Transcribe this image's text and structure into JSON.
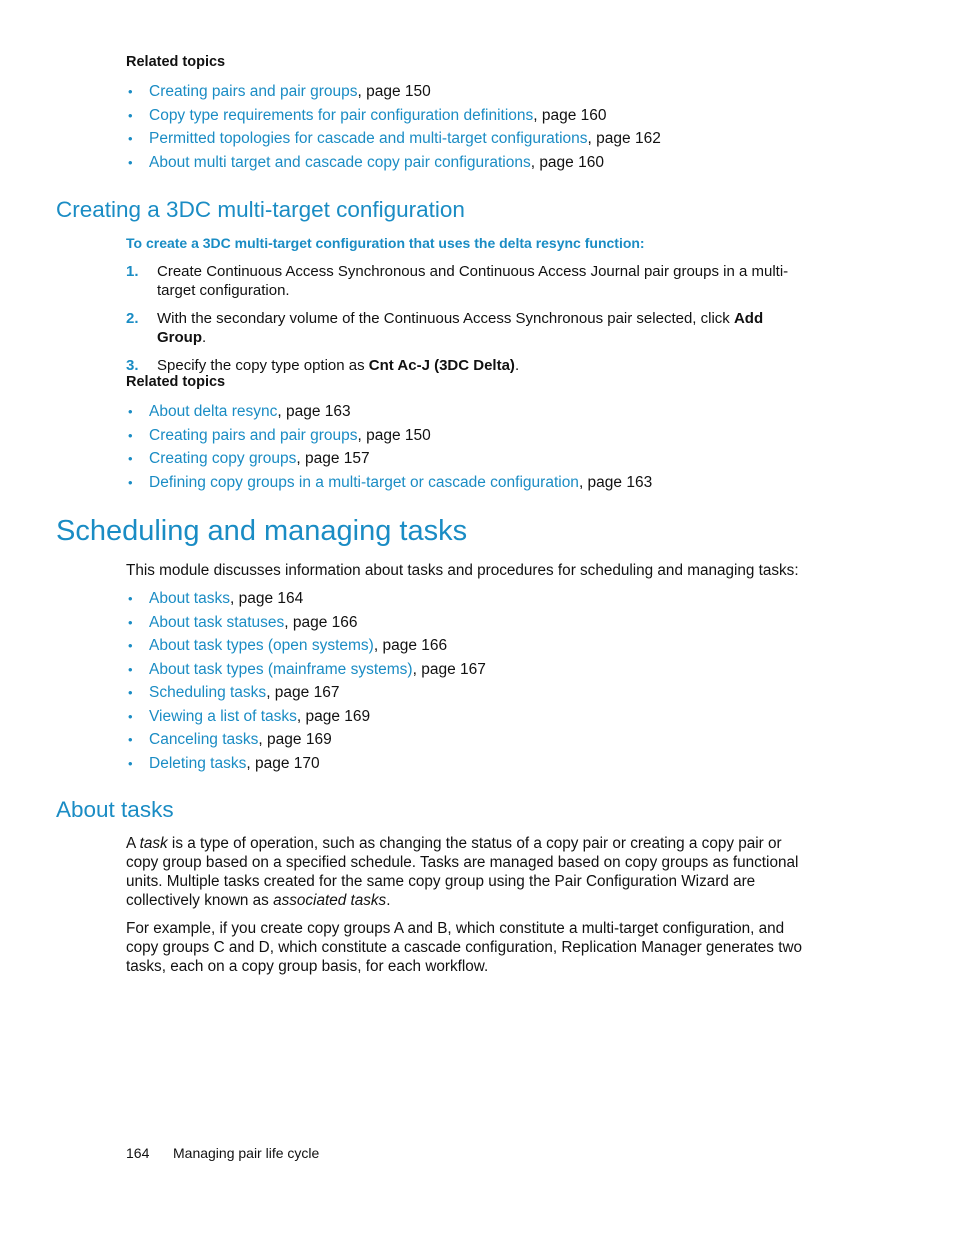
{
  "section1": {
    "related_title": "Related topics",
    "items": [
      {
        "link": "Creating pairs and pair groups",
        "suffix": ", page 150"
      },
      {
        "link": "Copy type requirements for pair configuration definitions",
        "suffix": ", page 160"
      },
      {
        "link": "Permitted topologies for cascade and multi-target configurations",
        "suffix": ", page 162"
      },
      {
        "link": "About multi target and cascade copy pair configurations",
        "suffix": ", page 160"
      }
    ]
  },
  "section2": {
    "heading": "Creating a 3DC multi-target configuration",
    "procedure_title": "To create a 3DC multi-target configuration that uses the delta resync function:",
    "steps": [
      {
        "num": "1.",
        "text": "Create Continuous Access Synchronous and Continuous Access Journal pair groups in a multi-target configuration."
      },
      {
        "num": "2.",
        "text_before": "With the secondary volume of the Continuous Access Synchronous pair selected, click ",
        "bold": "Add Group",
        "text_after": "."
      },
      {
        "num": "3.",
        "text_before": "Specify the copy type option as ",
        "bold": "Cnt Ac-J (3DC Delta)",
        "text_after": "."
      }
    ],
    "related_title": "Related topics",
    "items": [
      {
        "link": "About delta resync",
        "suffix": ", page 163"
      },
      {
        "link": "Creating pairs and pair groups",
        "suffix": ", page 150"
      },
      {
        "link": "Creating copy groups",
        "suffix": ", page 157"
      },
      {
        "link": "Defining copy groups in a multi-target or cascade configuration",
        "suffix": ", page 163"
      }
    ]
  },
  "section3": {
    "heading": "Scheduling and managing tasks",
    "intro": "This module discusses information about tasks and procedures for scheduling and managing tasks:",
    "items": [
      {
        "link": "About tasks",
        "suffix": ", page 164"
      },
      {
        "link": "About task statuses",
        "suffix": ", page 166"
      },
      {
        "link": "About task types (open systems)",
        "suffix": ", page 166"
      },
      {
        "link": "About task types (mainframe systems)",
        "suffix": ", page 167"
      },
      {
        "link": "Scheduling tasks",
        "suffix": ", page 167"
      },
      {
        "link": "Viewing a list of tasks",
        "suffix": ", page 169"
      },
      {
        "link": "Canceling tasks",
        "suffix": ", page 169"
      },
      {
        "link": "Deleting tasks",
        "suffix": ", page 170"
      }
    ]
  },
  "section4": {
    "heading": "About tasks",
    "para1": {
      "a": "A ",
      "task_italic": "task",
      "b": " is a type of operation, such as changing the status of a copy pair or creating a copy pair or copy group based on a specified schedule. Tasks are managed based on copy groups as functional units. Multiple tasks created for the same copy group using the Pair Configuration Wizard are collectively known as ",
      "assoc_italic": "associated tasks",
      "c": "."
    },
    "para2": "For example, if you create copy groups A and B, which constitute a multi-target configuration, and copy groups C and D, which constitute a cascade configuration, Replication Manager generates two tasks, each on a copy group basis, for each workflow."
  },
  "footer": {
    "page_number": "164",
    "chapter": "Managing pair life cycle"
  },
  "bullet_glyph": "•"
}
